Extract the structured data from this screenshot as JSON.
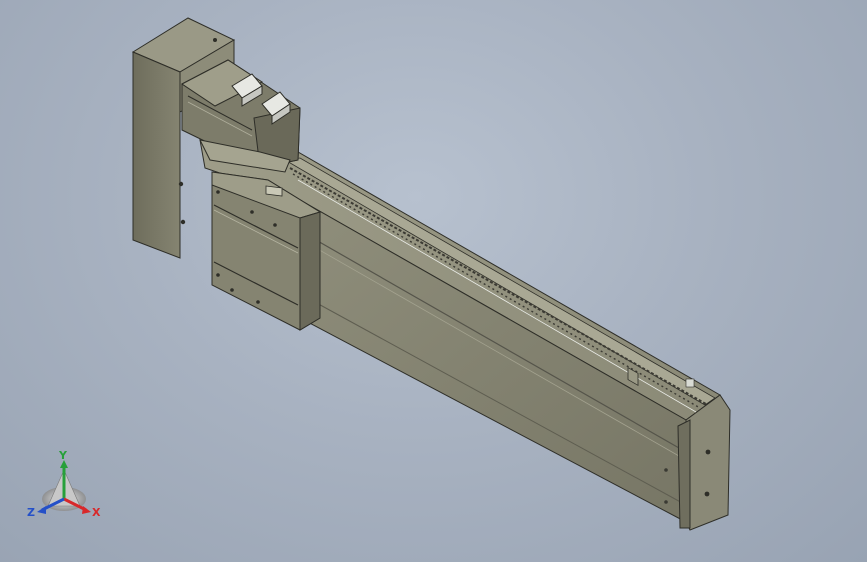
{
  "scene": {
    "description_none": "",
    "model": "linear-actuator",
    "colors": {
      "background_center": "#b7c1cf",
      "background_edge": "#98a3b3",
      "body_light": "#8e8d7a",
      "body_mid": "#7b7a68",
      "body_dark": "#5f5e50",
      "edge": "#2e2e28",
      "highlight": "#e9ebe6"
    }
  },
  "triad": {
    "x_label": "X",
    "y_label": "Y",
    "z_label": "Z",
    "x_color": "#d8282a",
    "y_color": "#27a03a",
    "z_color": "#2450c8"
  }
}
